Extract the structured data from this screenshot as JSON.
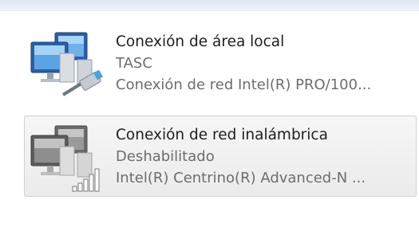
{
  "connections": [
    {
      "name": "Conexión de área local",
      "status": "TASC",
      "device": "Conexión de red Intel(R) PRO/100...",
      "icon": "wired-network-icon",
      "enabled": true
    },
    {
      "name": "Conexión de red inalámbrica",
      "status": "Deshabilitado",
      "device": "Intel(R) Centrino(R) Advanced-N ...",
      "icon": "wireless-network-icon",
      "enabled": false
    }
  ],
  "colors": {
    "selection_border": "#d0d0d0",
    "status_text": "#6d6d6d",
    "name_text": "#1e1e1e"
  }
}
